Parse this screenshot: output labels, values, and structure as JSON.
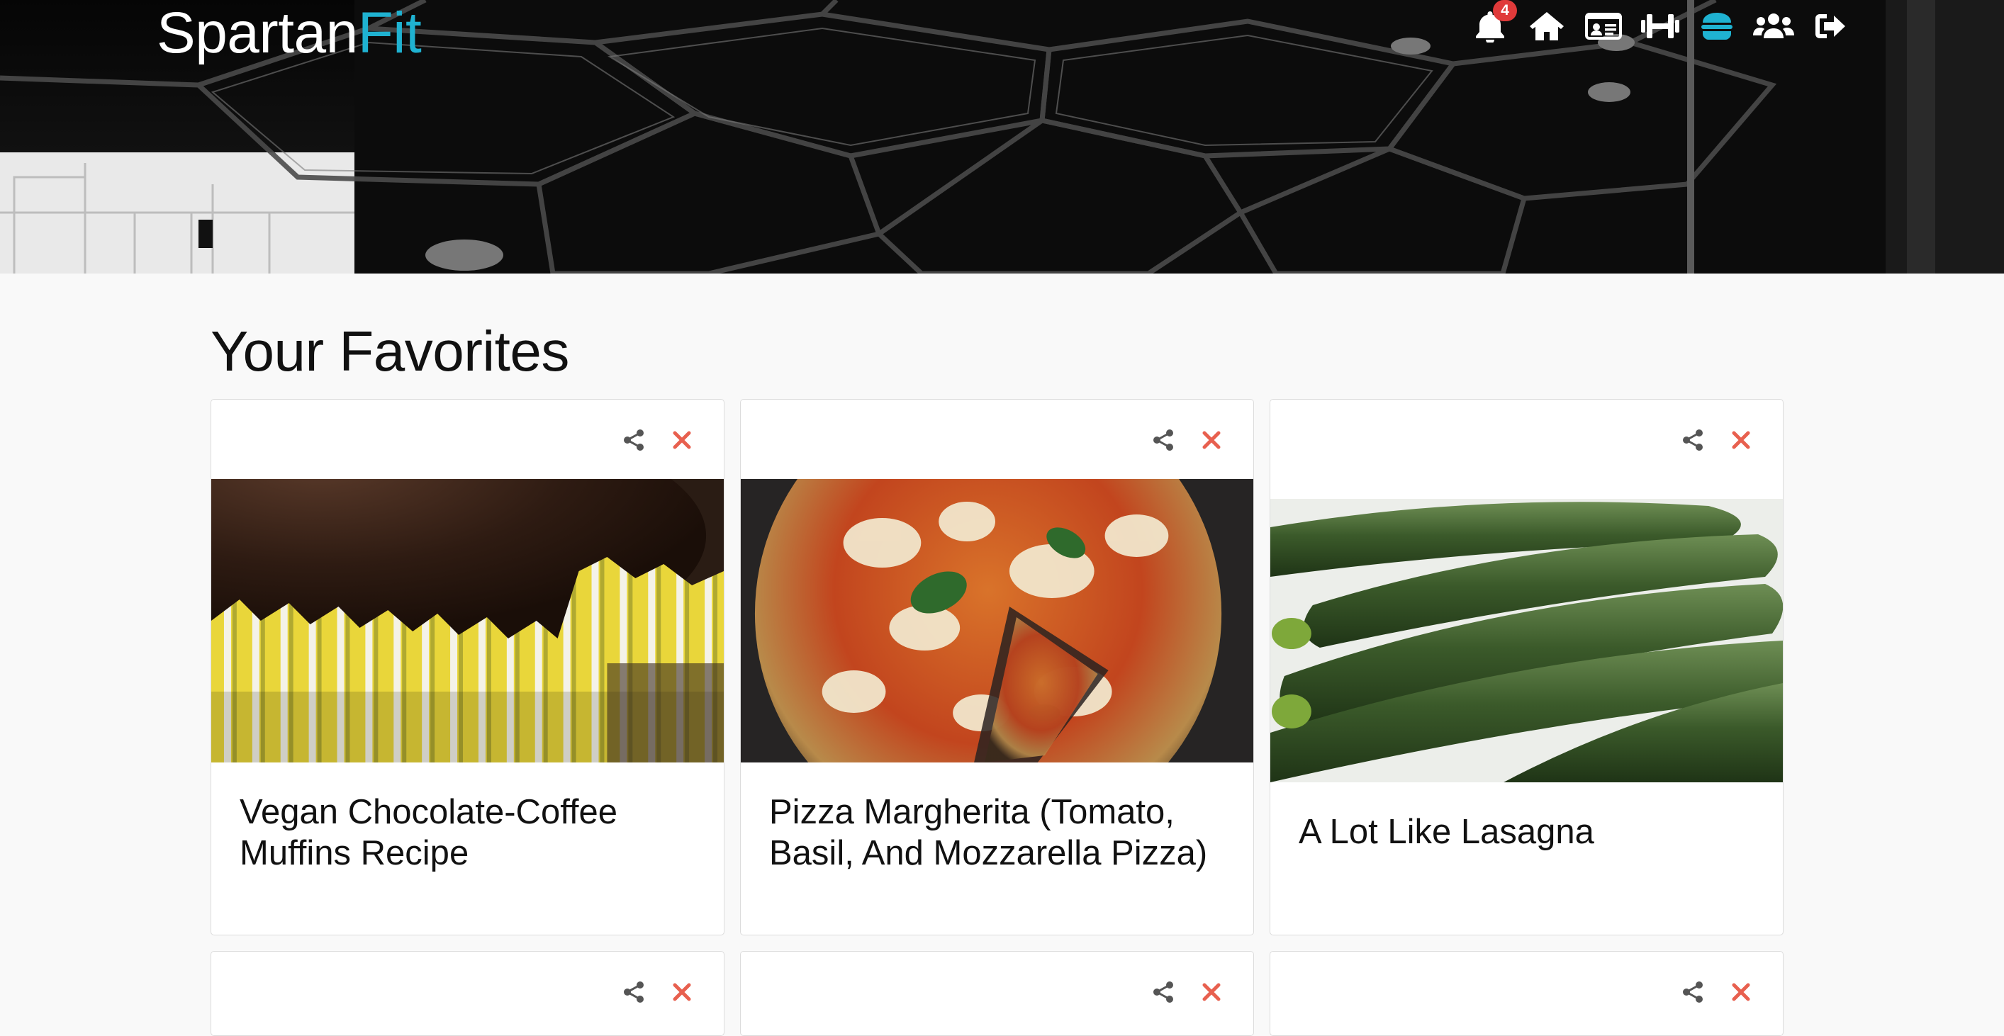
{
  "brand": {
    "name_part1": "Spartan",
    "name_part2": "Fit",
    "accent_color": "#1fb2d1"
  },
  "nav": {
    "items": [
      {
        "icon": "bell-icon",
        "badge": "4",
        "active": false
      },
      {
        "icon": "home-icon",
        "active": false
      },
      {
        "icon": "id-card-icon",
        "active": false
      },
      {
        "icon": "dumbbell-icon",
        "active": false
      },
      {
        "icon": "burger-icon",
        "active": true
      },
      {
        "icon": "users-icon",
        "active": false
      },
      {
        "icon": "sign-out-icon",
        "active": false
      }
    ]
  },
  "main": {
    "title": "Your Favorites",
    "cards": [
      {
        "title": "Vegan Chocolate-Coffee Muffins Recipe",
        "image": "chocolate-muffins-photo",
        "share_icon": "share-icon",
        "remove_icon": "close-icon"
      },
      {
        "title": "Pizza Margherita (Tomato, Basil, And Mozzarella Pizza)",
        "image": "pizza-margherita-photo",
        "share_icon": "share-icon",
        "remove_icon": "close-icon"
      },
      {
        "title": "A Lot Like Lasagna",
        "image": "zucchini-photo",
        "share_icon": "share-icon",
        "remove_icon": "close-icon"
      }
    ]
  },
  "colors": {
    "remove": "#e8604f",
    "share": "#555555",
    "active_nav": "#1fb2d1"
  }
}
